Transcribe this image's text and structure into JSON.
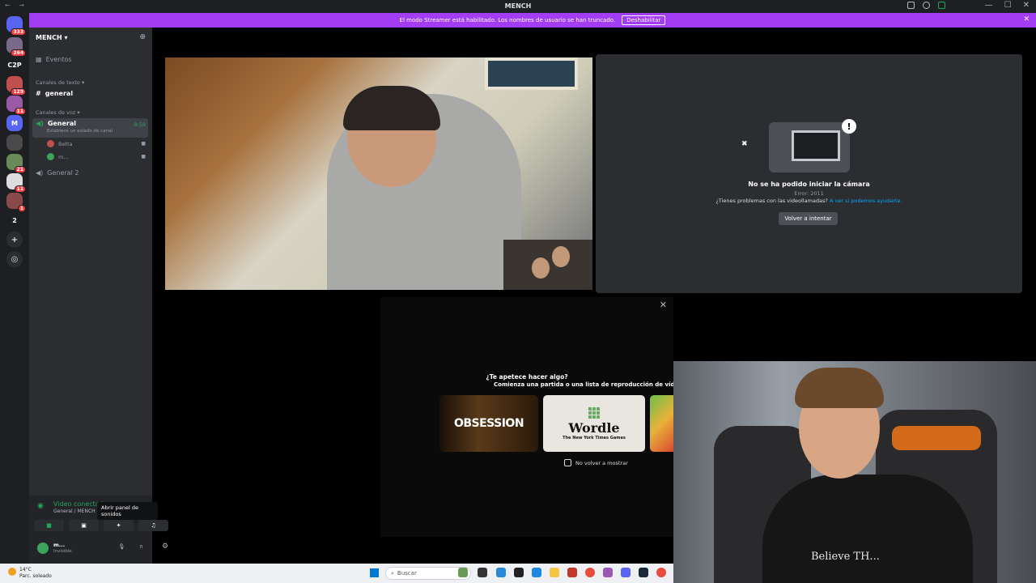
{
  "titlebar": {
    "title": "MENCH",
    "nav_arrows": "← →",
    "window_controls": [
      "—",
      "☐",
      "✕"
    ]
  },
  "servers": [
    {
      "label": "",
      "badge": "333"
    },
    {
      "label": "",
      "badge": "264"
    },
    {
      "label": "C2P",
      "badge": ""
    },
    {
      "label": "",
      "badge": "129"
    },
    {
      "label": "",
      "badge": "11"
    },
    {
      "label": "M",
      "badge": ""
    },
    {
      "label": "",
      "badge": ""
    },
    {
      "label": "",
      "badge": "21"
    },
    {
      "label": "",
      "badge": "11"
    },
    {
      "label": "",
      "badge": "1"
    },
    {
      "label": "2",
      "badge": ""
    }
  ],
  "banner": {
    "message": "El modo Streamer está habilitado. Los nombres de usuario se han truncado.",
    "button": "Deshabilitar",
    "close": "✕"
  },
  "sidebar": {
    "server_name": "MENCH",
    "events": "Eventos",
    "text_category": "Canales de texto",
    "text_channel": "general",
    "voice_category": "Canales de voz",
    "voice_channel": "General",
    "voice_time": "8:59",
    "voice_status": "Establece un estado de canal",
    "users": [
      "Betta",
      "m..."
    ],
    "voice_channel_2": "General 2"
  },
  "voice_panel": {
    "status": "Video conectado",
    "location": "General / MENCH"
  },
  "tooltip": "Abrir panel de sonidos",
  "user": {
    "name": "m...",
    "status": "Invisible"
  },
  "camera_error": {
    "title": "No se ha podido iniciar la cámara",
    "code": "Error: 2011",
    "help_text": "¿Tienes problemas con las videollamadas?",
    "help_link": "A ver si podemos ayudarte.",
    "retry": "Volver a intentar"
  },
  "activity": {
    "question": "¿Te apetece hacer algo?",
    "subtitle": "Comienza una partida o una lista de reproducción de vídeos al in",
    "cards": [
      "OBSESSION",
      "Wordle",
      "The New York Times Games"
    ],
    "dont_show": "No volver a mostrar"
  },
  "webcam": {
    "shirt_text": "Believe TH..."
  },
  "taskbar": {
    "weather_temp": "14°C",
    "weather_desc": "Parc. soleado",
    "search": "Buscar"
  }
}
